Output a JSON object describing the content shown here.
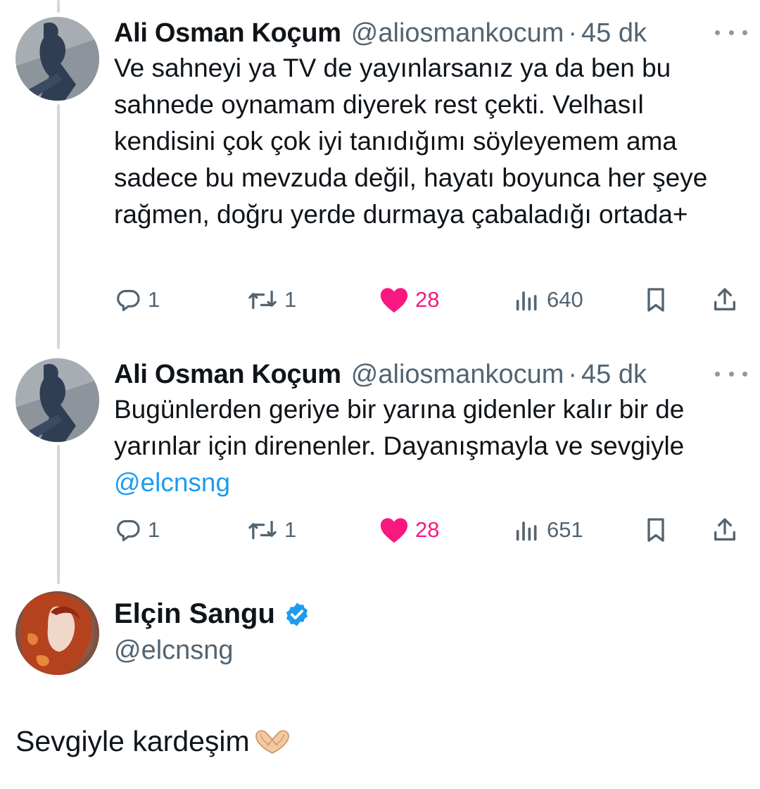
{
  "tweets": [
    {
      "name": "Ali Osman Koçum",
      "handle": "@aliosmankocum",
      "separator": "·",
      "time": "45 dk",
      "text": "Ve sahneyi ya TV de yayınlarsanız ya da ben bu sahnede oynamam diyerek rest çekti. Velhasıl kendisini çok çok iyi tanıdığımı söyleyemem ama sadece bu mevzuda değil, hayatı boyunca her şeye rağmen, doğru yerde durmaya çabaladığı ortada+",
      "stats": {
        "replies": "1",
        "retweets": "1",
        "likes": "28",
        "views": "640"
      }
    },
    {
      "name": "Ali Osman Koçum",
      "handle": "@aliosmankocum",
      "separator": "·",
      "time": "45 dk",
      "text": "Bugünlerden geriye bir yarına gidenler kalır bir de yarınlar için direnenler. Dayanışmayla ve sevgiyle",
      "mention": "@elcnsng",
      "stats": {
        "replies": "1",
        "retweets": "1",
        "likes": "28",
        "views": "651"
      }
    }
  ],
  "reply": {
    "name": "Elçin Sangu",
    "handle": "@elcnsng",
    "verified": true,
    "text": "Sevgiyle kardeşim",
    "emoji": "heart-hands"
  },
  "icons": [
    "reply-icon",
    "retweet-icon",
    "like-icon",
    "views-icon",
    "bookmark-icon",
    "share-icon",
    "more-icon",
    "verified-badge-icon"
  ],
  "colors": {
    "text": "#0f1419",
    "muted": "#536471",
    "like": "#f91880",
    "link": "#1d9bf0",
    "verified": "#1d9bf0",
    "thread": "#cfd9de"
  }
}
